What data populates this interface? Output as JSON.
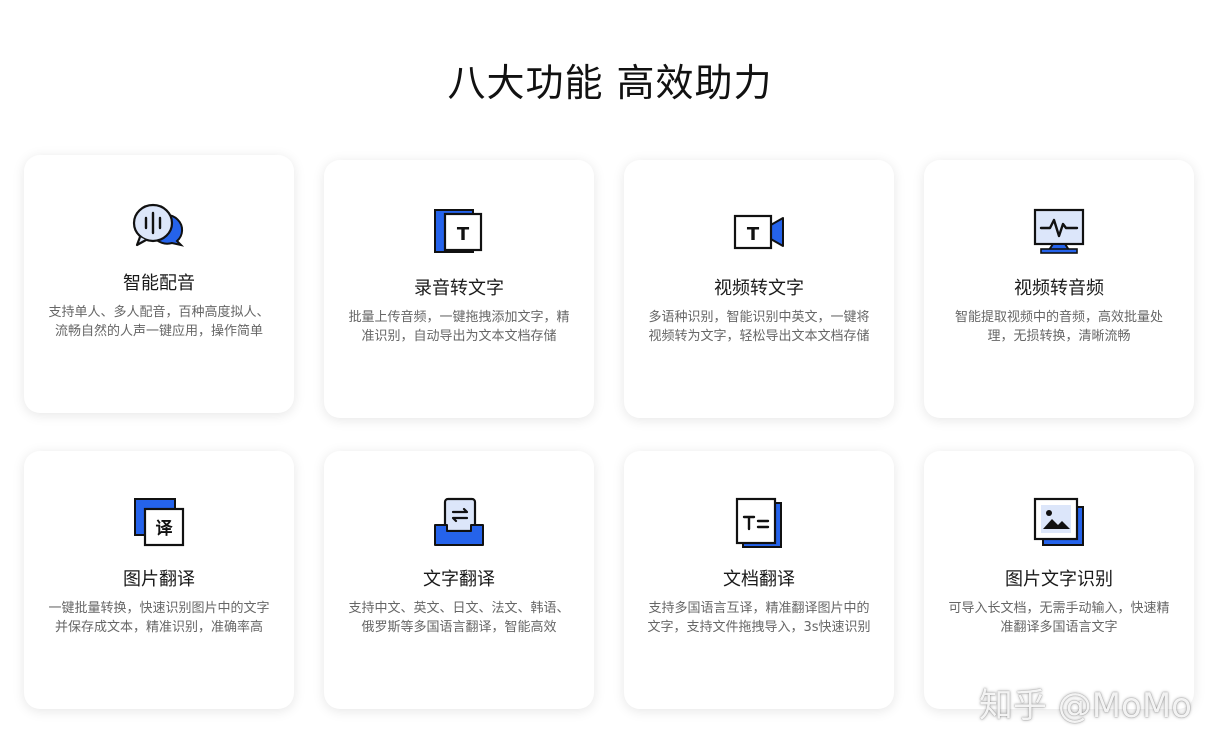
{
  "page": {
    "title": "八大功能 高效助力"
  },
  "cards": [
    {
      "title": "智能配音",
      "desc": "支持单人、多人配音，百种高度拟人、流畅自然的人声一键应用，操作简单",
      "icon": "voice-bubble-icon"
    },
    {
      "title": "录音转文字",
      "desc": "批量上传音频，一键拖拽添加文字，精准识别，自动导出为文本文档存储",
      "icon": "text-document-icon"
    },
    {
      "title": "视频转文字",
      "desc": "多语种识别，智能识别中英文，一键将视频转为文字，轻松导出文本文档存储",
      "icon": "video-text-icon"
    },
    {
      "title": "视频转音频",
      "desc": "智能提取视频中的音频，高效批量处理，无损转换，清晰流畅",
      "icon": "monitor-waveform-icon"
    },
    {
      "title": "图片翻译",
      "desc": "一键批量转换，快速识别图片中的文字并保存成文本，精准识别，准确率高",
      "icon": "image-translate-icon",
      "glyph": "译"
    },
    {
      "title": "文字翻译",
      "desc": "支持中文、英文、日文、法文、韩语、俄罗斯等多国语言翻译，智能高效",
      "icon": "text-swap-icon"
    },
    {
      "title": "文档翻译",
      "desc": "支持多国语言互译，精准翻译图片中的文字，支持文件拖拽导入，3s快速识别",
      "icon": "document-translate-icon"
    },
    {
      "title": "图片文字识别",
      "desc": "可导入长文档，无需手动输入，快速精准翻译多国语言文字",
      "icon": "image-recognition-icon"
    }
  ],
  "watermark": "知乎 @MoMo",
  "colors": {
    "accent": "#2563EB",
    "accent_light": "#DCE6FA",
    "outline": "#111111"
  }
}
